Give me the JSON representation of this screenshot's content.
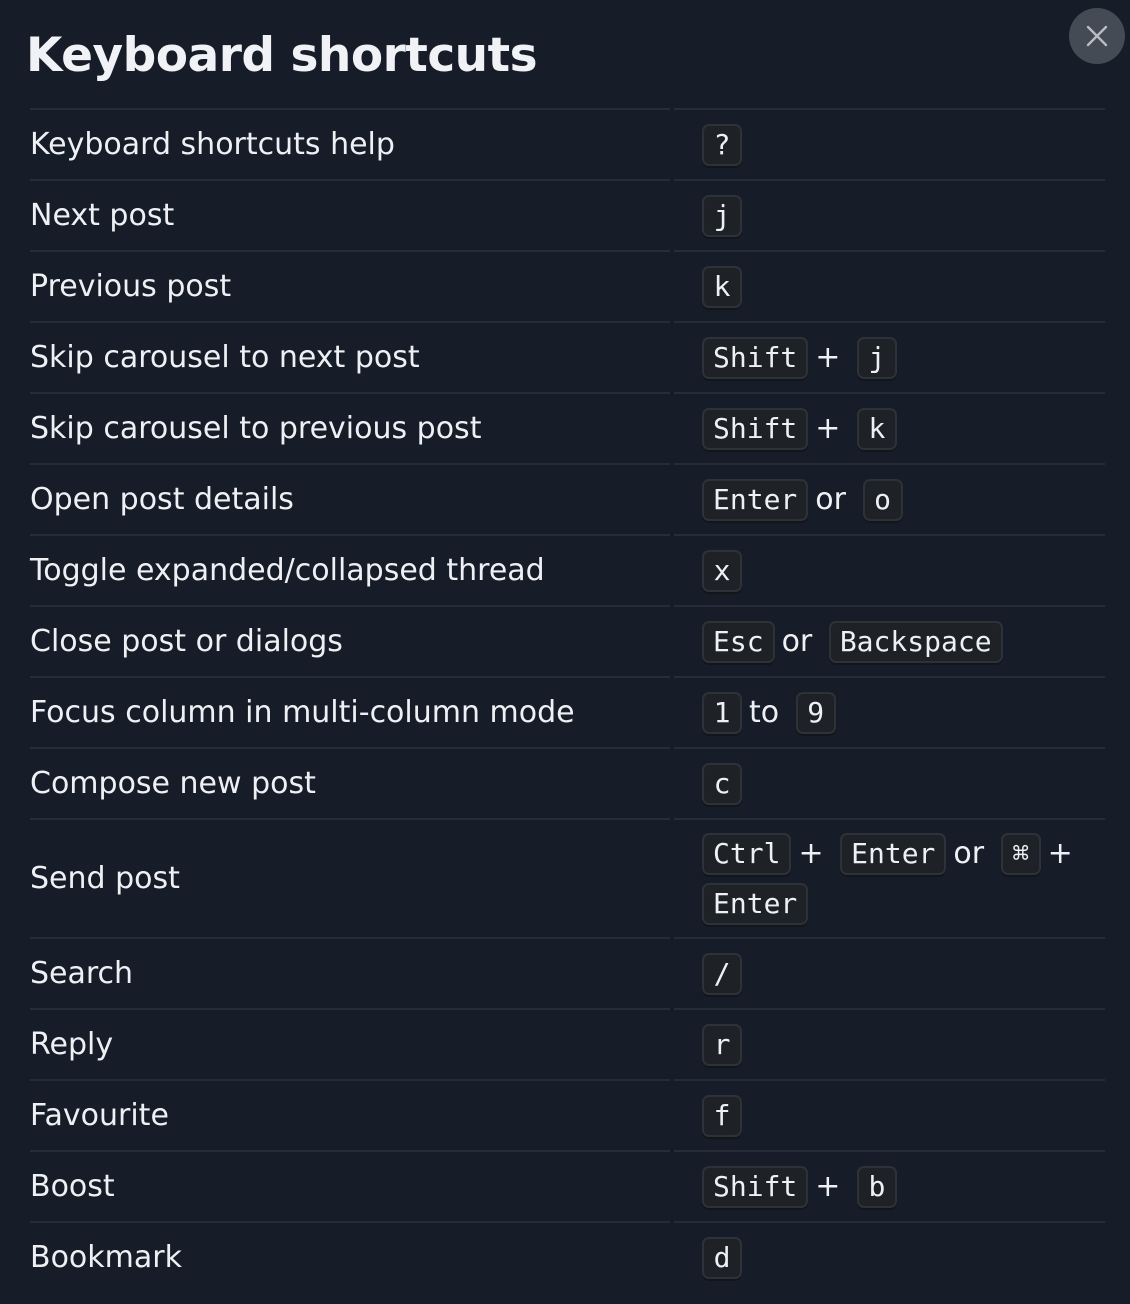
{
  "dialog": {
    "title": "Keyboard shortcuts",
    "close_icon": "close-icon"
  },
  "shortcuts": [
    {
      "label": "Keyboard shortcuts help",
      "keys": [
        "?"
      ],
      "seps": []
    },
    {
      "label": "Next post",
      "keys": [
        "j"
      ],
      "seps": []
    },
    {
      "label": "Previous post",
      "keys": [
        "k"
      ],
      "seps": []
    },
    {
      "label": "Skip carousel to next post",
      "keys": [
        "Shift",
        "j"
      ],
      "seps": [
        "+"
      ]
    },
    {
      "label": "Skip carousel to previous post",
      "keys": [
        "Shift",
        "k"
      ],
      "seps": [
        "+"
      ]
    },
    {
      "label": "Open post details",
      "keys": [
        "Enter",
        "o"
      ],
      "seps": [
        "or"
      ]
    },
    {
      "label": "Toggle expanded/collapsed thread",
      "keys": [
        "x"
      ],
      "seps": []
    },
    {
      "label": "Close post or dialogs",
      "keys": [
        "Esc",
        "Backspace"
      ],
      "seps": [
        "or"
      ]
    },
    {
      "label": "Focus column in multi-column mode",
      "keys": [
        "1",
        "9"
      ],
      "seps": [
        "to"
      ]
    },
    {
      "label": "Compose new post",
      "keys": [
        "c"
      ],
      "seps": []
    },
    {
      "label": "Send post",
      "keys": [
        "Ctrl",
        "Enter",
        "⌘",
        "Enter"
      ],
      "seps": [
        "+",
        "or",
        "+"
      ]
    },
    {
      "label": "Search",
      "keys": [
        "/"
      ],
      "seps": []
    },
    {
      "label": "Reply",
      "keys": [
        "r"
      ],
      "seps": []
    },
    {
      "label": "Favourite",
      "keys": [
        "f"
      ],
      "seps": []
    },
    {
      "label": "Boost",
      "keys": [
        "Shift",
        "b"
      ],
      "seps": [
        "+"
      ]
    },
    {
      "label": "Bookmark",
      "keys": [
        "d"
      ],
      "seps": []
    }
  ]
}
